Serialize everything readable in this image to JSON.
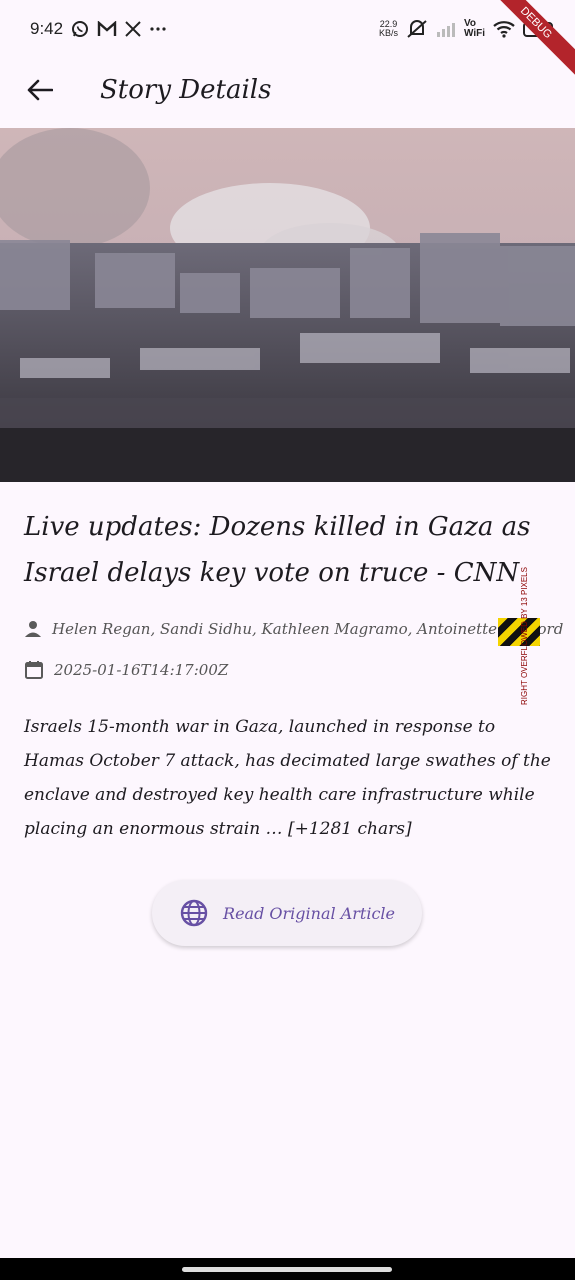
{
  "status_bar": {
    "time": "9:42",
    "net_speed_value": "22.9",
    "net_speed_unit": "KB/s",
    "vo_label": "Vo",
    "wifi_label": "WiFi",
    "battery": "22",
    "debug_label": "DEBUG",
    "icons": [
      "whatsapp-icon",
      "gmail-icon",
      "x-icon",
      "more-icon",
      "mute-icon",
      "signal-icon",
      "wifi-icon",
      "battery-icon"
    ]
  },
  "app_bar": {
    "title": "Story Details",
    "back_icon": "arrow-back-icon"
  },
  "article": {
    "hero_image": "city-smoke-photo",
    "title": "Live updates: Dozens killed in Gaza as Israel delays key vote on truce - CNN",
    "authors": "Helen Regan, Sandi Sidhu, Kathleen Magramo, Antoinette Radford",
    "date": "2025-01-16T14:17:00Z",
    "description": "Israels 15-month war in Gaza, launched in response to Hamas October 7 attack, has decimated large swathes of the enclave and destroyed key health care infrastructure while placing an enormous strain … [+1281 chars]",
    "read_button_label": "Read Original Article",
    "overflow_message": "RIGHT OVERFLOWED BY 13 PIXELS"
  },
  "colors": {
    "background": "#fdf7fe",
    "accent": "#6750a4",
    "debug_banner": "#b3242b"
  }
}
